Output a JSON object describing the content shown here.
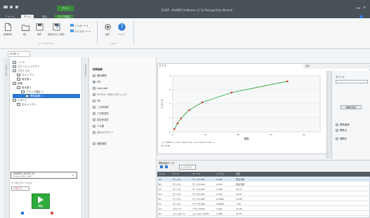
{
  "window": {
    "title": "ELISP・BioNBS Software v1.5a Recognition Module"
  },
  "tabs": [
    "ファイル",
    "ホーム",
    "表示",
    "グラフ形式"
  ],
  "context_tab": "グラフ",
  "ribbon": {
    "buttons": [
      {
        "label": "新規作成",
        "icon": "new-doc-icon"
      },
      {
        "label": "開く",
        "icon": "open-folder-icon"
      },
      {
        "label": "保存",
        "icon": "save-icon"
      },
      {
        "label": "名前を付けて保存",
        "icon": "save-as-icon"
      }
    ],
    "small_buttons": [
      "インポート ▾",
      "エクスポート ▾"
    ],
    "settings_label": "設定",
    "help_label": "ヘルプ",
    "group1": "ワークスペース",
    "group2": "ヘルプ"
  },
  "doc_tab": "ELISP ✕",
  "navigator": {
    "rail_label": "ナビゲーター",
    "items": [
      {
        "label": "ノート",
        "depth": 0
      },
      {
        "label": "プレートレイアウト",
        "depth": 0
      },
      {
        "label": "プロトコル",
        "depth": 0
      },
      {
        "label": "ステップ 1",
        "depth": 1
      },
      {
        "label": "吸光度 1",
        "depth": 1
      },
      {
        "label": "結果",
        "depth": 0
      },
      {
        "label": "吸光度 1",
        "depth": 1
      },
      {
        "label": "ブランク補正 1",
        "depth": 2
      },
      {
        "label": "標準曲線 1",
        "depth": 3
      },
      {
        "label": "レポート",
        "depth": 0
      },
      {
        "label": "セキュリティ",
        "depth": 1
      }
    ],
    "sample": {
      "name": "SAMPLE_ELISP_01",
      "desc": "ELISA_001_001"
    },
    "instrument_label": "インキュベーション",
    "temperature": "1.00 ℃",
    "run_label": "開始"
  },
  "task_panel": {
    "rail_label": "タスクパネル",
    "section_title": "回帰曲線",
    "options": [
      {
        "label": "線形補間",
        "on": false
      },
      {
        "label": "4PL",
        "on": true
      },
      {
        "label": "Log-Logit",
        "on": false
      },
      {
        "label": "5パラメータロジスティック",
        "on": false
      },
      {
        "label": "3PL",
        "on": false
      },
      {
        "label": "二次多項式",
        "on": false
      },
      {
        "label": "三次多項式",
        "on": false
      },
      {
        "label": "四次多項式",
        "on": false
      },
      {
        "label": "べき乗",
        "on": false
      },
      {
        "label": "点のスプライン",
        "on": false
      },
      {
        "label": "指数減衰",
        "on": false
      }
    ]
  },
  "chart_pane": {
    "tab": "グラフ",
    "formula": "y = ((44.4 + (-1.4 - 44.4) / (1 + (x / 53.2)^1.1)) + ...",
    "r2": "R²: 0.99",
    "right_header": "表示",
    "side_labels": [
      "タイトル",
      "",
      "標準曲線",
      "標準点",
      "補間点",
      "",
      ""
    ],
    "side_button": "軸書式設定"
  },
  "chart_data": {
    "type": "scatter",
    "title": "",
    "xlabel": "濃度",
    "ylabel": "シグナル",
    "xlim": [
      0,
      45
    ],
    "ylim": [
      0,
      4
    ],
    "x": [
      0.5,
      1.5,
      2.5,
      5,
      9,
      18,
      35
    ],
    "y": [
      0.2,
      0.6,
      0.95,
      1.55,
      2.1,
      2.8,
      3.6
    ],
    "xticks": [
      "0",
      "10",
      "20",
      "30",
      "40"
    ],
    "yticks": [
      "0",
      "1",
      "2",
      "3",
      "4"
    ]
  },
  "table": {
    "tab": "レイアウト",
    "section": "標準曲線データ",
    "columns": [
      "ウェル",
      "タイプ",
      "サンプル",
      "シグナル",
      "濃度"
    ],
    "rows": [
      [
        "A1",
        "サンプル",
        "サンプル001",
        "2.165",
        "算出可能"
      ],
      [
        "B1",
        "サンプル",
        "サンプル002",
        "2.152",
        "算出可能"
      ],
      [
        "C1",
        "サンプル",
        "サンプル003",
        "2.308",
        "12.70"
      ],
      [
        "D1",
        "サンプル",
        "サンプル004",
        "2.722",
        "12.97"
      ],
      [
        "E1",
        "サンプル",
        "サンプル005",
        "0.0906",
        "13.36"
      ],
      [
        "F1",
        "サンプル",
        "サンプル006",
        "0.0906",
        "7.56"
      ],
      [
        "G1",
        "ブランク",
        "ブランク001",
        "1.321",
        "11.38"
      ],
      [
        "H1",
        "コントロール",
        "コントロール001",
        "1.499",
        "12.70"
      ]
    ]
  }
}
